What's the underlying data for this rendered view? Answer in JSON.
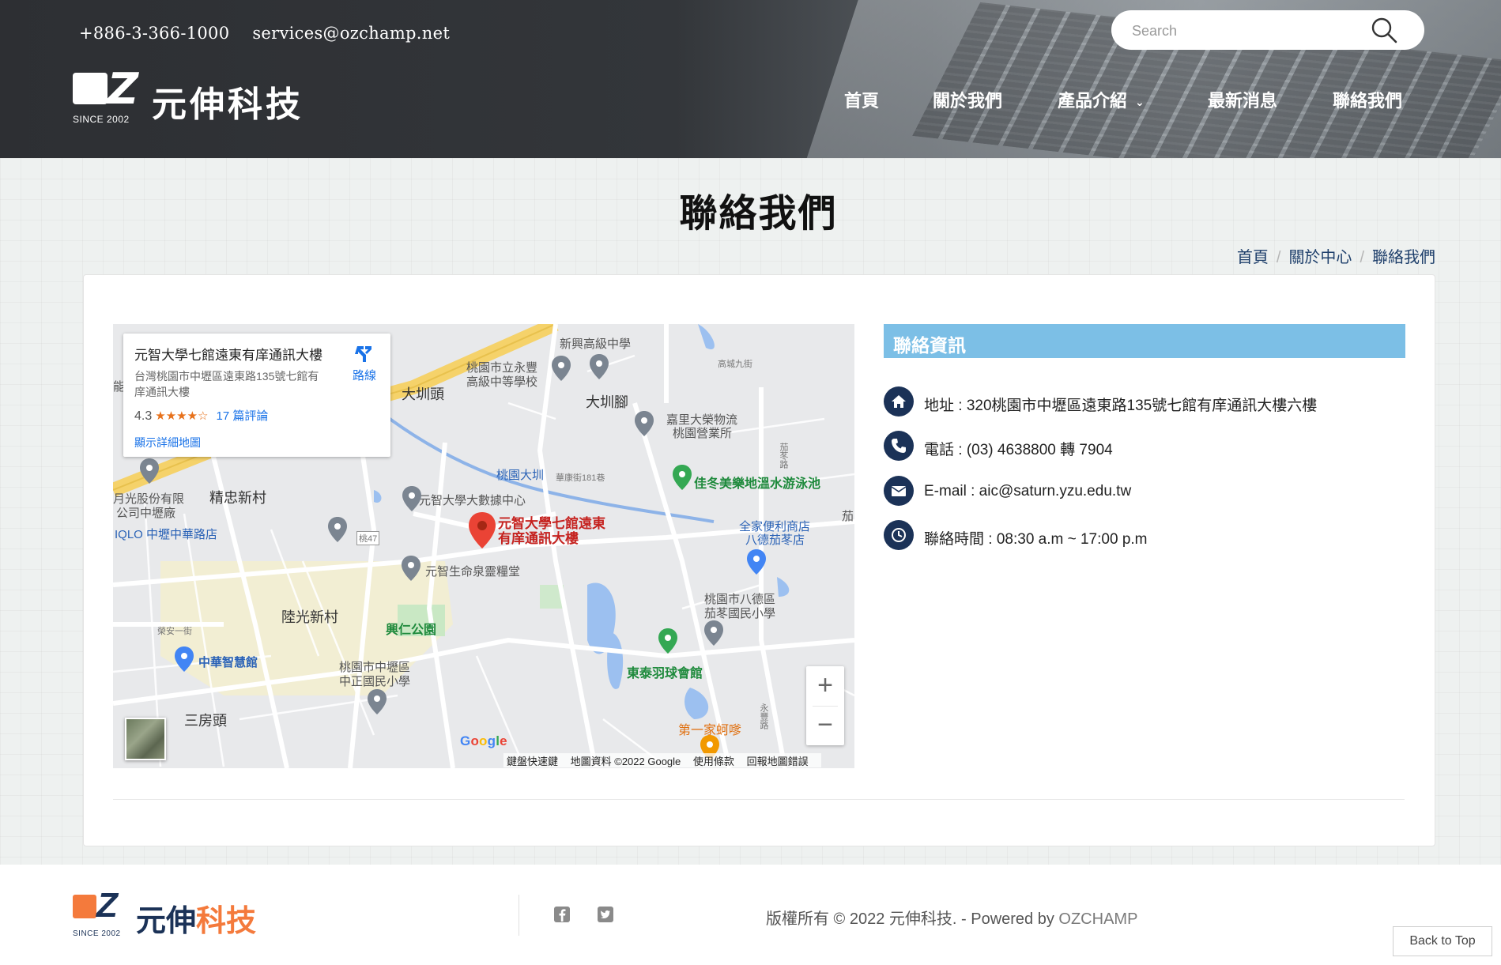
{
  "header": {
    "phone": "+886-3-366-1000",
    "email": "services@ozchamp.net",
    "logo_since": "SINCE 2002",
    "logo_name": "元伸科技",
    "search_placeholder": "Search",
    "nav": [
      {
        "label": "首頁"
      },
      {
        "label": "關於我們"
      },
      {
        "label": "產品介紹",
        "has_dropdown": true
      },
      {
        "label": "最新消息"
      },
      {
        "label": "聯絡我們"
      }
    ]
  },
  "page": {
    "title": "聯絡我們",
    "breadcrumb": [
      "首頁",
      "關於中心",
      "聯絡我們"
    ]
  },
  "map": {
    "place_title": "元智大學七館遠東有庠通訊大樓",
    "place_address": "台灣桃園市中壢區遠東路135號七館有庠通訊大樓",
    "rating": "4.3",
    "stars": "★★★★☆",
    "reviews": "17 篇評論",
    "directions": "路線",
    "larger_map": "顯示詳細地圖",
    "pin_label_line1": "元智大學七館遠東",
    "pin_label_line2": "有庠通訊大樓",
    "labels": {
      "l1": "新興高級中學",
      "l2": "桃園市立永豐",
      "l3": "高級中等學校",
      "l4": "大圳頭",
      "l5": "大圳腳",
      "l6": "嘉里大榮物流",
      "l7": "桃園營業所",
      "l8": "桃園大圳",
      "l9": "華康街181巷",
      "l10": "佳冬美樂地溫水游泳池",
      "l11": "精忠新村",
      "l12": "元智大學大數據中心",
      "l13": "月光股份有限",
      "l14": "公司中壢廠",
      "l15": "IQLO 中壢中華路店",
      "l16": "全家便利商店",
      "l17": "八德茄苳店",
      "l18": "元智生命泉靈糧堂",
      "l19": "陸光新村",
      "l20": "興仁公園",
      "l21": "桃園市八德區",
      "l22": "茄苳國民小學",
      "l23": "中華智慧館",
      "l24": "桃園市中壢區",
      "l25": "中正國民小學",
      "l26": "東泰羽球會館",
      "l27": "三房頭",
      "l28": "第一家蚵嗲",
      "l29": "榮安一街",
      "l30": "高城九街",
      "l31": "茄苳路",
      "l32": "永豐路",
      "l33": "桃47",
      "l34": "能",
      "l35": "茄"
    },
    "google": "Google",
    "footer_items": [
      "鍵盤快速鍵",
      "地圖資料 ©2022 Google",
      "使用條款",
      "回報地圖錯誤"
    ],
    "zoom_in": "+",
    "zoom_out": "−"
  },
  "contact": {
    "heading": "聯絡資訊",
    "address": "地址 : 320桃園市中壢區遠東路135號七館有庠通訊大樓六樓",
    "phone": "電話 : (03) 4638800 轉 7904",
    "email": "E-mail : aic@saturn.yzu.edu.tw",
    "hours": "聯絡時間 : 08:30 a.m ~ 17:00 p.m"
  },
  "footer": {
    "logo_since": "SINCE 2002",
    "logo_name_a": "元伸",
    "logo_name_b": "科技",
    "copyright": "版權所有 © 2022 元伸科技. - Powered by ",
    "brand": "OZCHAMP",
    "back_to_top": "Back to Top"
  },
  "colors": {
    "accent_orange": "#f47a3c",
    "navy": "#1b3257",
    "info_header": "#7cbfe6"
  }
}
